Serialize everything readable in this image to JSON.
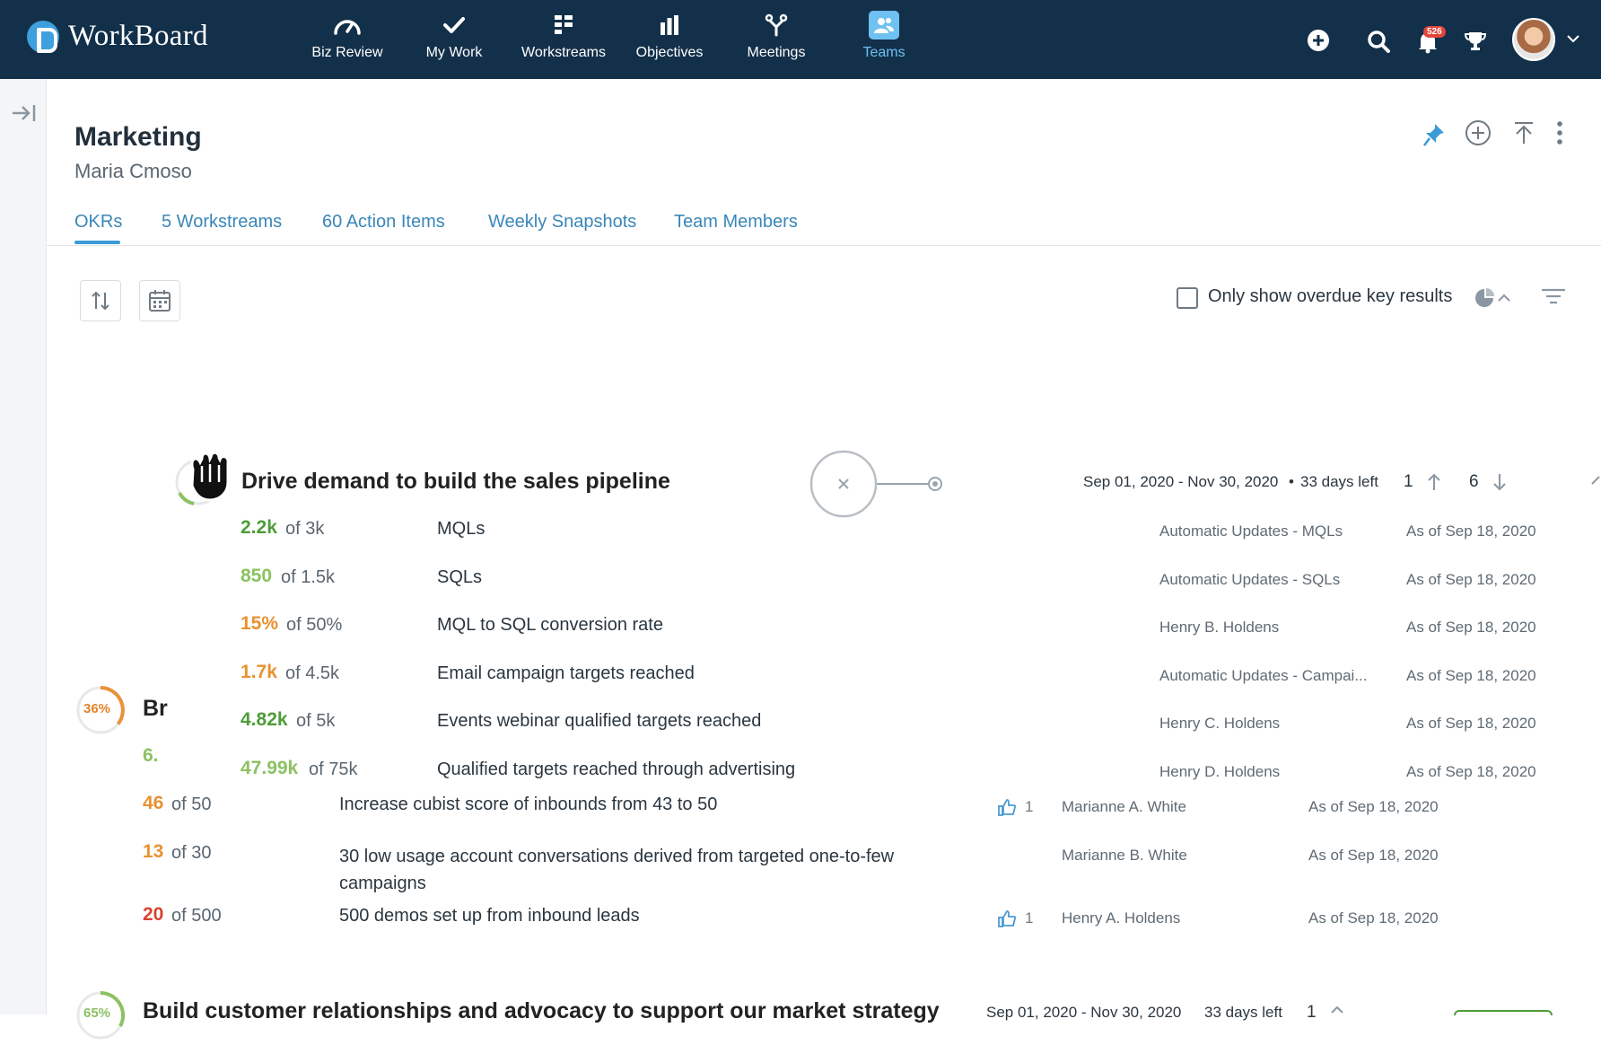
{
  "app": {
    "name": "WorkBoard"
  },
  "nav": [
    {
      "label": "Biz Review",
      "icon": "gauge-icon"
    },
    {
      "label": "My Work",
      "icon": "check-icon"
    },
    {
      "label": "Workstreams",
      "icon": "grid-icon"
    },
    {
      "label": "Objectives",
      "icon": "bar-chart-icon"
    },
    {
      "label": "Meetings",
      "icon": "merge-icon"
    },
    {
      "label": "Teams",
      "icon": "people-icon"
    }
  ],
  "header": {
    "notification_count": "526"
  },
  "page": {
    "title": "Marketing",
    "owner": "Maria Cmoso"
  },
  "tabs": [
    {
      "label": "OKRs"
    },
    {
      "label": "5 Workstreams"
    },
    {
      "label": "60 Action Items"
    },
    {
      "label": "Weekly Snapshots"
    },
    {
      "label": "Team Members"
    }
  ],
  "filters": {
    "overdue_label": "Only show overdue key results"
  },
  "objective1": {
    "title": "Drive demand to build the sales pipeline",
    "dates": "Sep 01, 2020 - Nov 30, 2020",
    "days_left": "33  days left",
    "up_count": "1",
    "down_count": "6",
    "key_results": [
      {
        "value": "2.2k",
        "of": "of 3k",
        "desc": "MQLs",
        "owner": "Automatic Updates - MQLs",
        "date": "As of Sep 18, 2020",
        "color": "green"
      },
      {
        "value": "850",
        "of": "of 1.5k",
        "desc": "SQLs",
        "owner": "Automatic Updates - SQLs",
        "date": "As of Sep 18, 2020",
        "color": "lgreen"
      },
      {
        "value": "15%",
        "of": "of 50%",
        "desc": "MQL to SQL conversion rate",
        "owner": "Henry B. Holdens",
        "date": "As of Sep 18, 2020",
        "color": "orange"
      },
      {
        "value": "1.7k",
        "of": "of 4.5k",
        "desc": "Email campaign targets reached",
        "owner": "Automatic Updates - Campai...",
        "date": "As of Sep 18, 2020",
        "color": "orange"
      },
      {
        "value": "4.82k",
        "of": "of 5k",
        "desc": "Events webinar qualified targets reached",
        "owner": "Henry C. Holdens",
        "date": "As of Sep 18, 2020",
        "color": "green"
      },
      {
        "value": "47.99k",
        "of": "of 75k",
        "desc": "Qualified targets reached through advertising",
        "owner": "Henry D. Holdens",
        "date": "As of Sep 18, 2020",
        "color": "lgreen"
      }
    ]
  },
  "objective2": {
    "progress": "36%",
    "title_fragment": "Br",
    "value_fragment": "6.",
    "key_results": [
      {
        "value": "46",
        "of": "of 50",
        "desc": "Increase cubist score of inbounds from 43 to 50",
        "likes": "1",
        "owner": "Marianne A. White",
        "date": "As of Sep 18, 2020",
        "color": "orange"
      },
      {
        "value": "13",
        "of": "of 30",
        "desc": "30 low usage account conversations derived from targeted one-to-few campaigns",
        "likes": "",
        "owner": "Marianne B. White",
        "date": "As of Sep 18, 2020",
        "color": "orange"
      },
      {
        "value": "20",
        "of": "of 500",
        "desc": "500 demos set up from inbound leads",
        "likes": "1",
        "owner": "Henry A. Holdens",
        "date": "As of Sep 18, 2020",
        "color": "red"
      }
    ]
  },
  "objective3": {
    "progress": "65%",
    "title": "Build customer relationships and advocacy to support our market strategy",
    "dates": "Sep 01, 2020 - Nov 30, 2020",
    "days_left": "33  days left",
    "up_count": "1"
  }
}
